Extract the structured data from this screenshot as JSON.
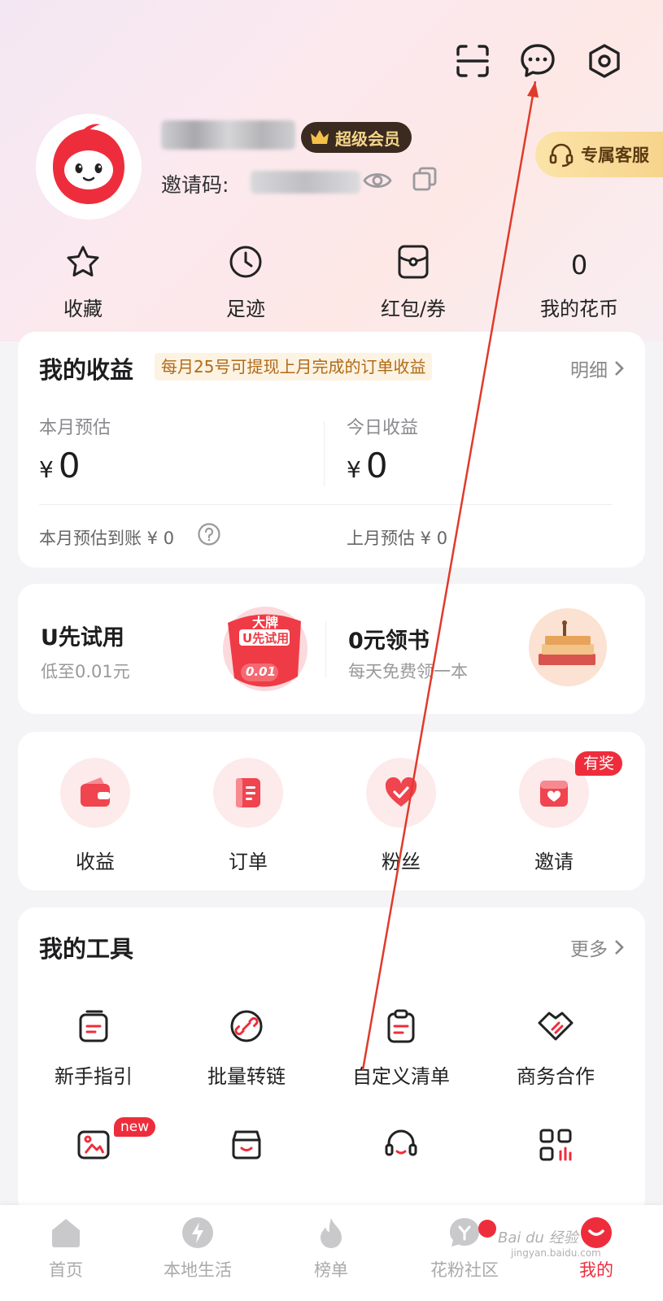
{
  "colors": {
    "accent": "#ee2d3c",
    "gold": "#f5d58b",
    "note_bg": "#fdf3e3"
  },
  "header": {
    "icons": [
      "scan-icon",
      "message-icon",
      "settings-icon"
    ]
  },
  "profile": {
    "vip_label": "超级会员",
    "invite_label": "邀请码:",
    "customer_service_label": "专属客服"
  },
  "quick_links": [
    {
      "label": "收藏",
      "icon": "star-icon"
    },
    {
      "label": "足迹",
      "icon": "clock-icon"
    },
    {
      "label": "红包/券",
      "icon": "coupon-icon"
    },
    {
      "label": "我的花币",
      "value": "0"
    }
  ],
  "earnings": {
    "title": "我的收益",
    "note": "每月25号可提现上月完成的订单收益",
    "detail_label": "明细",
    "month_estimate_label": "本月预估",
    "month_estimate_currency": "¥",
    "month_estimate_value": "0",
    "today_label": "今日收益",
    "today_currency": "¥",
    "today_value": "0",
    "month_arrival_text": "本月预估到账 ¥ 0",
    "last_month_text": "上月预估 ¥ 0"
  },
  "promos": [
    {
      "title": "U先试用",
      "subtitle": "低至0.01元",
      "badge_text": "大牌",
      "badge_text2": "U先试用",
      "badge_price": "0.01"
    },
    {
      "title": "0元领书",
      "subtitle": "每天免费领一本"
    }
  ],
  "functions": [
    {
      "label": "收益",
      "icon": "wallet-icon"
    },
    {
      "label": "订单",
      "icon": "order-icon"
    },
    {
      "label": "粉丝",
      "icon": "heart-icon"
    },
    {
      "label": "邀请",
      "icon": "invite-icon",
      "badge": "有奖"
    }
  ],
  "tools": {
    "title": "我的工具",
    "more_label": "更多",
    "items": [
      {
        "label": "新手指引",
        "icon": "guide-icon"
      },
      {
        "label": "批量转链",
        "icon": "link-icon"
      },
      {
        "label": "自定义清单",
        "icon": "clipboard-icon"
      },
      {
        "label": "商务合作",
        "icon": "handshake-icon"
      },
      {
        "label": "",
        "icon": "image-icon",
        "badge": "new"
      },
      {
        "label": "",
        "icon": "shop-icon"
      },
      {
        "label": "",
        "icon": "headset-icon"
      },
      {
        "label": "",
        "icon": "apps-icon"
      }
    ]
  },
  "nav": {
    "items": [
      {
        "label": "首页",
        "icon": "home-icon"
      },
      {
        "label": "本地生活",
        "icon": "lightning-icon"
      },
      {
        "label": "榜单",
        "icon": "flame-icon"
      },
      {
        "label": "花粉社区",
        "icon": "community-icon"
      },
      {
        "label": "我的",
        "icon": "profile-icon",
        "active": true
      }
    ],
    "watermark": "Bai du 经验",
    "watermark_sub": "jingyan.baidu.com"
  }
}
